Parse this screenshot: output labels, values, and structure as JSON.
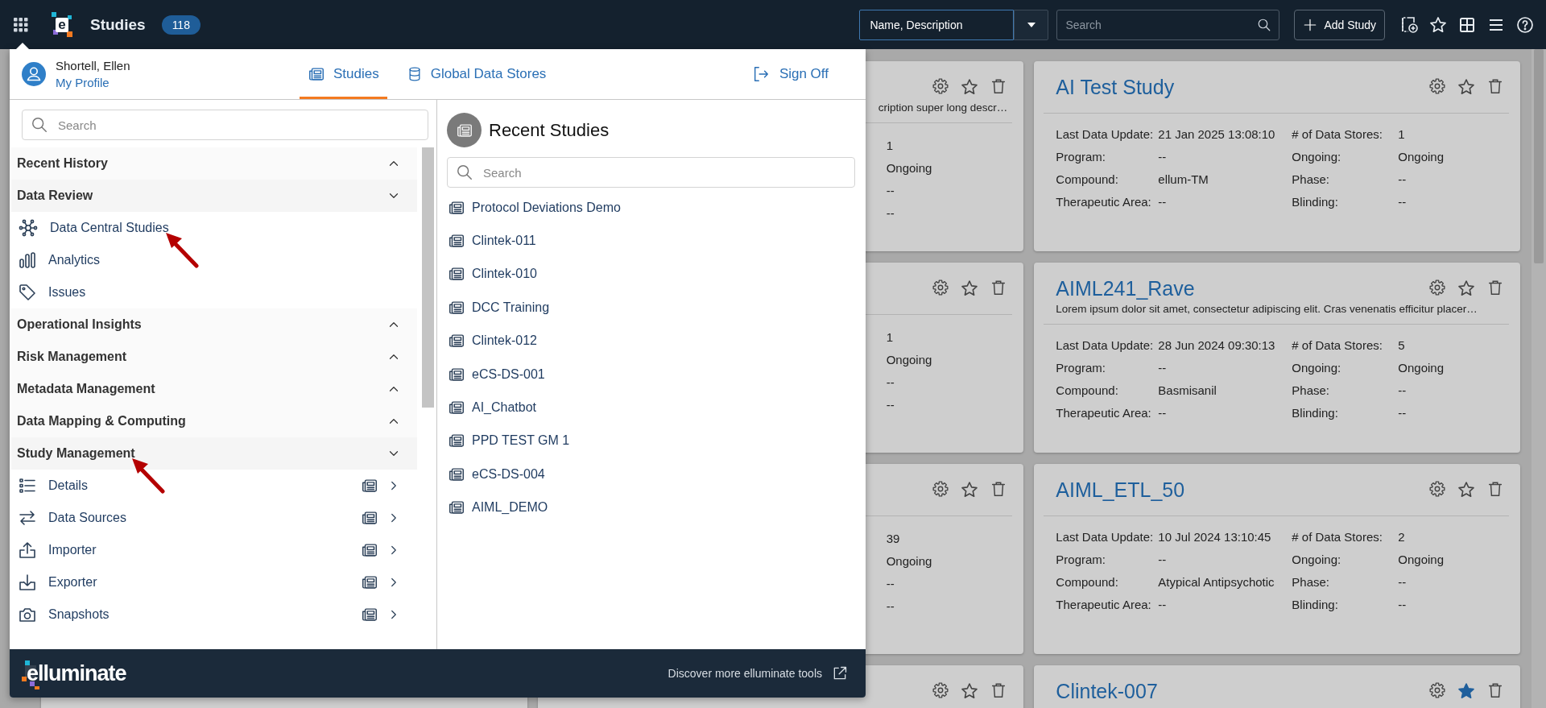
{
  "top_bar": {
    "logo_letter": "e",
    "title": "Studies",
    "count": "118",
    "search_scope": "Name, Description",
    "search": {
      "placeholder": "Search"
    },
    "add_button": "Add Study"
  },
  "menu": {
    "user": {
      "name": "Shortell, Ellen",
      "profile_link": "My Profile"
    },
    "tabs": [
      {
        "label": "Studies",
        "selected": true
      },
      {
        "label": "Global Data Stores",
        "selected": false
      }
    ],
    "sign_off": "Sign Off",
    "nav_search": {
      "placeholder": "Search"
    },
    "sections": [
      {
        "title": "Recent History",
        "expanded": false
      },
      {
        "title": "Data Review",
        "expanded": true,
        "annotated": false,
        "items": [
          {
            "label": "Data Central Studies",
            "kind": "plain",
            "annotated": true
          },
          {
            "label": "Analytics",
            "kind": "plain",
            "annotated": false
          },
          {
            "label": "Issues",
            "kind": "plain",
            "annotated": false
          }
        ]
      },
      {
        "title": "Operational Insights",
        "expanded": false
      },
      {
        "title": "Risk Management",
        "expanded": false
      },
      {
        "title": "Metadata Management",
        "expanded": false
      },
      {
        "title": "Data Mapping & Computing",
        "expanded": false
      },
      {
        "title": "Study Management",
        "expanded": true,
        "annotated": true,
        "items": [
          {
            "label": "Details",
            "kind": "study",
            "annotated": false
          },
          {
            "label": "Data Sources",
            "kind": "study",
            "annotated": false
          },
          {
            "label": "Importer",
            "kind": "study",
            "annotated": false
          },
          {
            "label": "Exporter",
            "kind": "study",
            "annotated": false
          },
          {
            "label": "Snapshots",
            "kind": "study",
            "annotated": false
          }
        ]
      }
    ],
    "recent_studies": {
      "title": "Recent Studies",
      "search": {
        "placeholder": "Search"
      },
      "items": [
        "Protocol Deviations Demo",
        "Clintek-011",
        "Clintek-010",
        "DCC Training",
        "Clintek-012",
        "eCS-DS-001",
        "AI_Chatbot",
        "PPD TEST GM 1",
        "eCS-DS-004",
        "AIML_DEMO"
      ]
    },
    "footer": {
      "brand": "elluminate",
      "link": "Discover more elluminate tools"
    }
  },
  "card_rows": [
    {
      "partial_card": {
        "description": "cription super long descr…",
        "favorite": false,
        "values": [
          "1",
          "Ongoing",
          "--",
          "--"
        ]
      },
      "card": {
        "title": "AI Test Study",
        "favorite": false,
        "field_rows": [
          [
            {
              "label": "Last Data Update:",
              "value": "21 Jan 2025 13:08:10"
            },
            {
              "label": "# of Data Stores:",
              "value": "1"
            }
          ],
          [
            {
              "label": "Program:",
              "value": "--"
            },
            {
              "label": "Ongoing:",
              "value": "Ongoing"
            }
          ],
          [
            {
              "label": "Compound:",
              "value": "ellum-TM"
            },
            {
              "label": "Phase:",
              "value": "--"
            }
          ],
          [
            {
              "label": "Therapeutic Area:",
              "value": "--"
            },
            {
              "label": "Blinding:",
              "value": "--"
            }
          ]
        ]
      }
    },
    {
      "partial_card": {
        "favorite": false,
        "values": [
          "1",
          "Ongoing",
          "--",
          "--"
        ]
      },
      "card": {
        "title": "AIML241_Rave",
        "description": "Lorem ipsum dolor sit amet, consectetur adipiscing elit. Cras venenatis efficitur placer…",
        "favorite": false,
        "field_rows": [
          [
            {
              "label": "Last Data Update:",
              "value": "28 Jun 2024 09:30:13"
            },
            {
              "label": "# of Data Stores:",
              "value": "5"
            }
          ],
          [
            {
              "label": "Program:",
              "value": "--"
            },
            {
              "label": "Ongoing:",
              "value": "Ongoing"
            }
          ],
          [
            {
              "label": "Compound:",
              "value": "Basmisanil"
            },
            {
              "label": "Phase:",
              "value": "--"
            }
          ],
          [
            {
              "label": "Therapeutic Area:",
              "value": "--"
            },
            {
              "label": "Blinding:",
              "value": "--"
            }
          ]
        ]
      }
    },
    {
      "partial_card": {
        "favorite": false,
        "values": [
          "39",
          "Ongoing",
          "--",
          "--"
        ]
      },
      "card": {
        "title": "AIML_ETL_50",
        "favorite": false,
        "field_rows": [
          [
            {
              "label": "Last Data Update:",
              "value": "10 Jul 2024 13:10:45"
            },
            {
              "label": "# of Data Stores:",
              "value": "2"
            }
          ],
          [
            {
              "label": "Program:",
              "value": "--"
            },
            {
              "label": "Ongoing:",
              "value": "Ongoing"
            }
          ],
          [
            {
              "label": "Compound:",
              "value": "Atypical Antipsychotic"
            },
            {
              "label": "Phase:",
              "value": "--"
            }
          ],
          [
            {
              "label": "Therapeutic Area:",
              "value": "--"
            },
            {
              "label": "Blinding:",
              "value": "--"
            }
          ]
        ]
      }
    },
    {
      "partial_card": {
        "favorite": false
      },
      "card": {
        "title": "Clintek-007",
        "favorite": true
      }
    }
  ]
}
